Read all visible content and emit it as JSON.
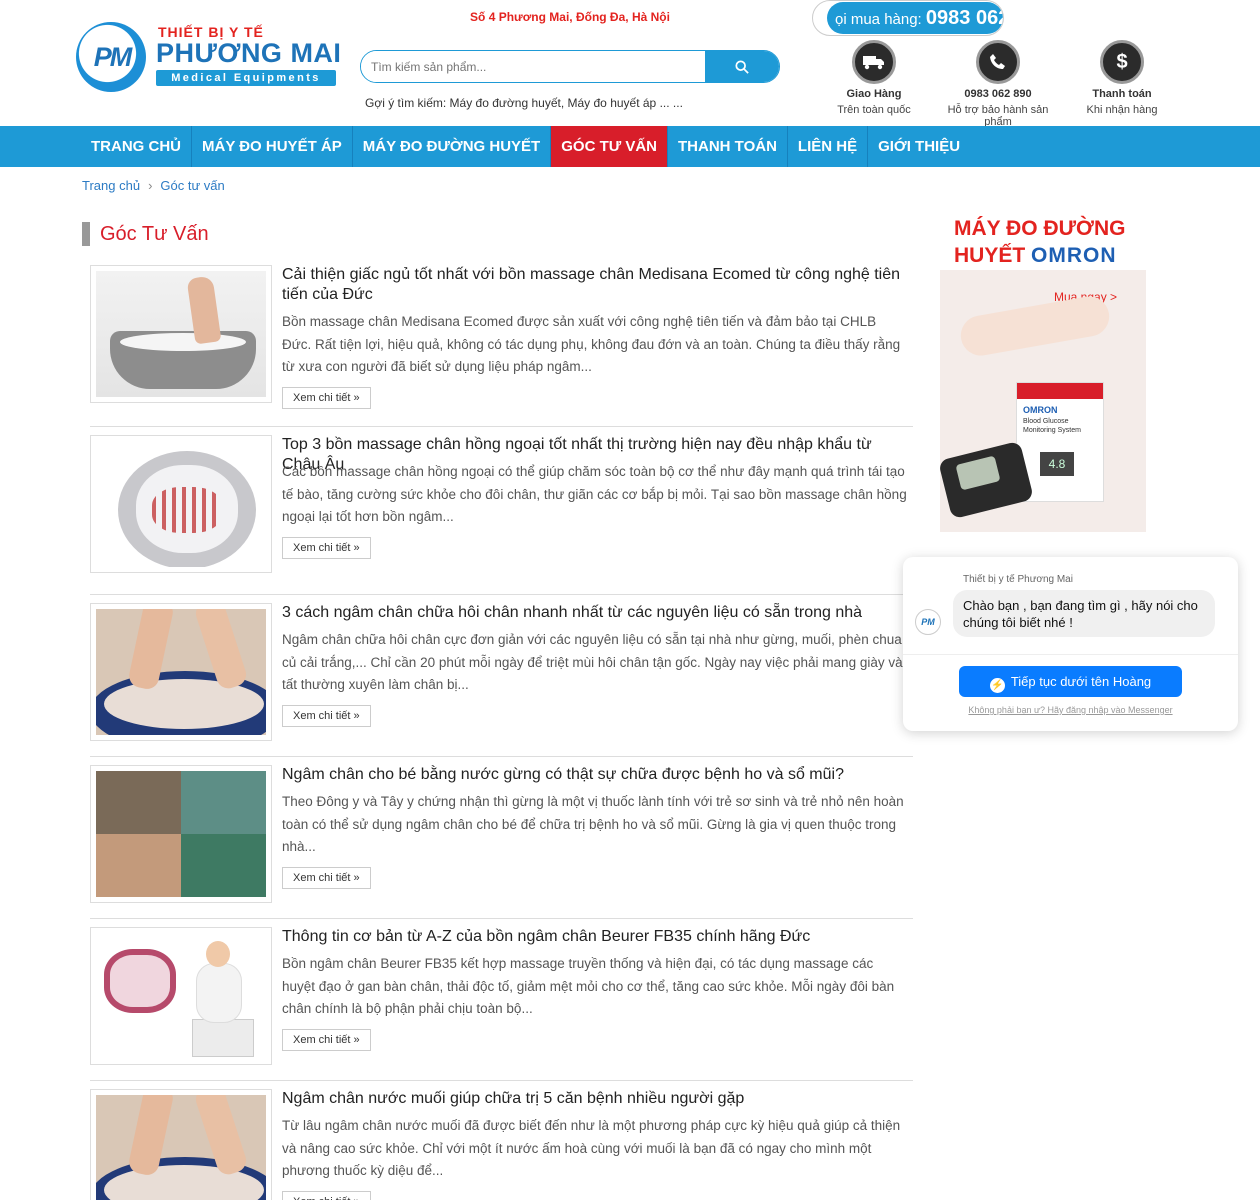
{
  "header": {
    "logo_top": "THIẾT BỊ Y TẾ",
    "logo_main": "PHƯƠNG MAI",
    "logo_sub": "Medical Equipments",
    "address": "Số 4 Phương Mai, Đống Đa, Hà Nội",
    "search_placeholder": "Tìm kiếm sản phẩm...",
    "suggest": "Gợi ý tìm kiếm: Máy đo đường huyết, Máy đo huyết áp ... ...",
    "hotline_label": "ọi mua hàng:",
    "hotline_number": "0983 062",
    "features": [
      {
        "icon": "truck-icon",
        "title": "Giao Hàng",
        "sub": "Trên toàn quốc"
      },
      {
        "icon": "phone-icon",
        "title": "0983 062 890",
        "sub": "Hỗ trợ bảo hành sản phẩm"
      },
      {
        "icon": "dollar-icon",
        "title": "Thanh toán",
        "sub": "Khi nhận hàng"
      }
    ]
  },
  "nav": {
    "items": [
      "TRANG CHỦ",
      "MÁY ĐO HUYẾT ÁP",
      "MÁY ĐO ĐƯỜNG HUYẾT",
      "GÓC TƯ VẤN",
      "THANH TOÁN",
      "LIÊN HỆ",
      "GIỚI THIỆU"
    ],
    "active_index": 3
  },
  "breadcrumb": {
    "home": "Trang chủ",
    "current": "Góc tư vấn"
  },
  "section_title": "Góc Tư Vấn",
  "more_label": "Xem chi tiết »",
  "articles": [
    {
      "title": "Cải thiện giấc ngủ tốt nhất với bồn massage chân Medisana Ecomed từ công nghệ tiên tiến của Đức",
      "desc": "Bồn massage chân Medisana Ecomed được sản xuất với công nghệ tiên tiến và đảm bảo tại CHLB Đức. Rất tiện lợi, hiệu quả, không có tác dụng phụ, không đau đớn và an toàn. Chúng ta điều thấy rằng từ xưa con người đã biết sử dụng liệu pháp ngâm..."
    },
    {
      "title": "Top 3 bồn massage chân hồng ngoại tốt nhất thị trường hiện nay đều nhập khẩu từ Châu Âu",
      "desc": "Các bồn massage chân hồng ngoại có thể giúp chăm sóc toàn bộ cơ thể như đây mạnh quá trình tái tạo tế bào, tăng cường sức khỏe cho đôi chân, thư giãn các cơ bắp bị mỏi. Tại sao bồn massage chân hồng ngoại lại tốt hơn bồn ngâm..."
    },
    {
      "title": "3 cách ngâm chân chữa hôi chân nhanh nhất từ các nguyên liệu có sẵn trong nhà",
      "desc": "Ngâm chân chữa hôi chân cực đơn giản với các nguyên liệu có sẵn tại nhà như gừng, muối, phèn chua, củ cải trắng,... Chỉ cần 20 phút mỗi ngày để triệt mùi hôi chân tận gốc. Ngày nay việc phải mang giày và tất thường xuyên làm chân bị..."
    },
    {
      "title": "Ngâm chân cho bé bằng nước gừng có thật sự chữa được bệnh ho và sổ mũi?",
      "desc": "Theo Đông y và Tây y chứng nhận thì gừng là một vị thuốc lành tính với trẻ sơ sinh và trẻ nhỏ nên hoàn toàn có thể sử dụng ngâm chân cho bé để chữa trị bệnh ho và sổ mũi. Gừng là gia vị quen thuộc trong nhà..."
    },
    {
      "title": "Thông tin cơ bản từ A-Z của bồn ngâm chân Beurer FB35 chính hãng Đức",
      "desc": "Bồn ngâm chân Beurer FB35 kết hợp massage truyền thống và hiện đại, có tác dụng massage các huyệt đạo ở gan bàn chân, thải độc tố, giảm mệt mỏi cho cơ thể, tăng cao sức khỏe. Mỗi ngày đôi bàn chân chính là bộ phận phải chịu toàn bộ..."
    },
    {
      "title": "Ngâm chân nước muối giúp chữa trị 5 căn bệnh nhiều người gặp",
      "desc": "Từ lâu ngâm chân nước muối đã được biết đến như là một phương pháp cực kỳ hiệu quả giúp cả thiện và nâng cao sức khỏe. Chỉ với một ít nước ấm hoà cùng với muối là bạn đã có ngay cho mình một phương thuốc kỳ diệu để..."
    }
  ],
  "banner": {
    "line1": "MÁY ĐO ĐƯỜNG",
    "line2": "HUYẾT",
    "brand": "OMRON",
    "buy": "Mua ngay >",
    "box_brand": "OMRON",
    "box_text": "Blood Glucose Monitoring System",
    "screen": "4.8"
  },
  "chat": {
    "page_name": "Thiết bị y tế Phương Mai",
    "message": "Chào bạn , bạn đang tìm gì , hãy nói cho chúng tôi biết nhé !",
    "button": "Tiếp tục dưới tên Hoàng",
    "note": "Không phải bạn ư? Hãy đăng nhập vào Messenger",
    "avatar": "PM"
  },
  "colors": {
    "brand_blue": "#1e9ad6",
    "accent_red": "#d81e2a",
    "messenger_blue": "#0a7cff"
  }
}
